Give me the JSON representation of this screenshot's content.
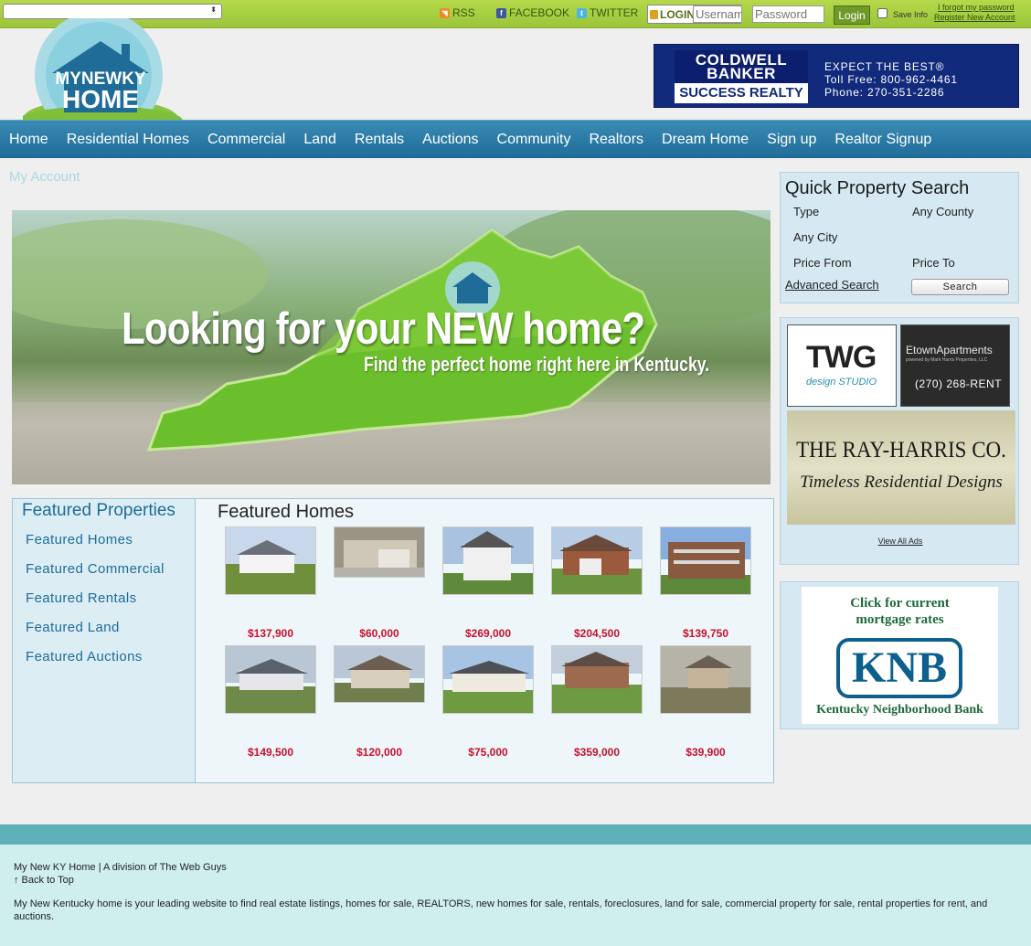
{
  "topbar": {
    "links": {
      "rss": "RSS",
      "facebook": "FACEBOOK",
      "twitter": "TWITTER"
    },
    "login": {
      "label": "LOGIN",
      "username_placeholder": "Username",
      "password_placeholder": "Password",
      "button": "Login",
      "save_info": "Save Info",
      "forgot": "I forgot my password",
      "register": "Register New Account"
    }
  },
  "header": {
    "logo": {
      "line1": "MYNEWKY",
      "line2": "HOME"
    },
    "banner": {
      "brand": "COLDWELL BANKER",
      "office": "SUCCESS REALTY",
      "slogan": "EXPECT THE BEST®",
      "toll_free": "Toll Free: 800-962-4461",
      "phone": "Phone: 270-351-2286"
    }
  },
  "nav": {
    "items": [
      "Home",
      "Residential Homes",
      "Commercial",
      "Land",
      "Rentals",
      "Auctions",
      "Community",
      "Realtors",
      "Dream Home",
      "Sign up",
      "Realtor Signup"
    ]
  },
  "my_account": "My Account",
  "hero": {
    "title": "Looking for your NEW home?",
    "subtitle": "Find the perfect home right here in Kentucky."
  },
  "featured": {
    "sidebar_title": "Featured Properties",
    "sidebar_items": [
      "Featured Homes",
      "Featured Commercial",
      "Featured Rentals",
      "Featured Land",
      "Featured Auctions"
    ],
    "main_title": "Featured Homes",
    "listings": [
      {
        "price": "$137,900"
      },
      {
        "price": "$60,000"
      },
      {
        "price": "$269,000"
      },
      {
        "price": "$204,500"
      },
      {
        "price": "$139,750"
      },
      {
        "price": "$149,500"
      },
      {
        "price": "$120,000"
      },
      {
        "price": "$75,000"
      },
      {
        "price": "$359,000"
      },
      {
        "price": "$39,900"
      }
    ]
  },
  "quick_search": {
    "title": "Quick Property Search",
    "type": "Type",
    "county": "Any County",
    "city": "Any City",
    "price_from": "Price From",
    "price_to": "Price To",
    "advanced": "Advanced Search",
    "button": "Search"
  },
  "ads": {
    "twg": {
      "name": "TWG",
      "tagline": "design STUDIO"
    },
    "etown": {
      "name": "EtownApartments",
      "tagline": "powered by Mark Harris Properties, LLC",
      "phone": "(270) 268-RENT"
    },
    "ray_harris": {
      "name": "THE RAY-HARRIS CO.",
      "tagline": "Timeless Residential Designs"
    },
    "view_all": "View All Ads",
    "knb": {
      "top": "Click for current mortgage rates",
      "logo": "KNB",
      "bottom": "Kentucky Neighborhood Bank"
    }
  },
  "footer": {
    "line1": "My New KY Home | A division of The Web Guys",
    "back_to_top": "↑ Back to Top",
    "description": "My New Kentucky home is your leading website to find real estate listings, homes for sale, REALTORS, new homes for sale, rentals, foreclosures, land for sale, commercial property for sale, rental properties for rent, and auctions."
  },
  "colors": {
    "topbar": "#a8cf42",
    "nav": "#2a7aa7",
    "price": "#c8102e",
    "panel": "#d6e9f2",
    "footer": "#cfeeee"
  }
}
